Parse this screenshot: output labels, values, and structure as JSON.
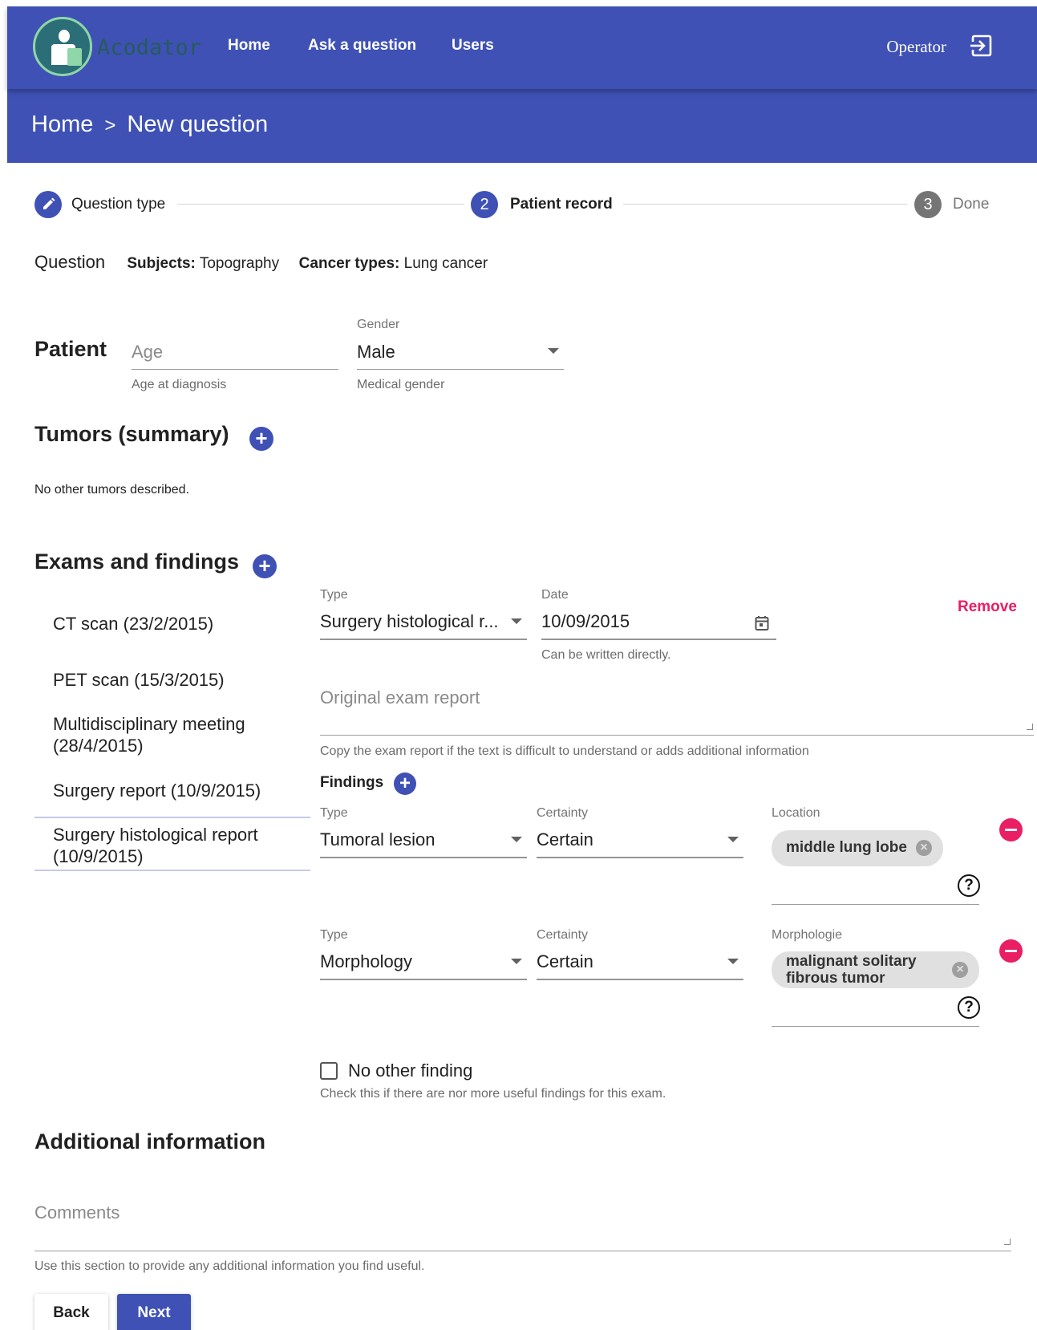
{
  "app": {
    "name": "Acodator"
  },
  "nav": {
    "home": "Home",
    "ask": "Ask a question",
    "users": "Users",
    "operator": "Operator"
  },
  "breadcrumb": {
    "home": "Home",
    "separator": ">",
    "current": "New question"
  },
  "stepper": {
    "steps": [
      {
        "label": "Question type",
        "state": "edit"
      },
      {
        "number": "2",
        "label": "Patient record",
        "state": "active"
      },
      {
        "number": "3",
        "label": "Done",
        "state": "pending"
      }
    ]
  },
  "question": {
    "title": "Question",
    "subjects_label": "Subjects:",
    "subjects_value": "Topography",
    "cancer_label": "Cancer types:",
    "cancer_value": "Lung cancer"
  },
  "patient": {
    "title": "Patient",
    "age_placeholder": "Age",
    "age_hint": "Age at diagnosis",
    "gender_label": "Gender",
    "gender_value": "Male",
    "gender_hint": "Medical gender"
  },
  "tumors": {
    "title": "Tumors (summary)",
    "empty_text": "No other tumors described."
  },
  "exams": {
    "title": "Exams and findings",
    "list": [
      {
        "label": "CT scan (23/2/2015)"
      },
      {
        "label": "PET scan (15/3/2015)"
      },
      {
        "label": "Multidisciplinary meeting (28/4/2015)"
      },
      {
        "label": "Surgery report (10/9/2015)"
      },
      {
        "label": "Surgery histological report (10/9/2015)"
      }
    ],
    "detail": {
      "type_label": "Type",
      "type_value": "Surgery histological r...",
      "date_label": "Date",
      "date_value": "10/09/2015",
      "date_hint": "Can be written directly.",
      "remove": "Remove",
      "report_placeholder": "Original exam report",
      "report_hint": "Copy the exam report if the text is difficult to understand or adds additional information",
      "findings_title": "Findings",
      "findings": [
        {
          "type_label": "Type",
          "type_value": "Tumoral lesion",
          "certainty_label": "Certainty",
          "certainty_value": "Certain",
          "extra_label": "Location",
          "chip": "middle lung lobe"
        },
        {
          "type_label": "Type",
          "type_value": "Morphology",
          "certainty_label": "Certainty",
          "certainty_value": "Certain",
          "extra_label": "Morphologie",
          "chip_line1": "malignant solitary",
          "chip_line2": "fibrous tumor"
        }
      ],
      "no_other_label": "No other finding",
      "no_other_hint": "Check this if there are nor more useful findings for this exam."
    }
  },
  "additional": {
    "title": "Additional information",
    "comments_placeholder": "Comments",
    "comments_hint": "Use this section to provide any additional information you find useful."
  },
  "buttons": {
    "back": "Back",
    "next": "Next"
  },
  "colors": {
    "primary": "#3f51b5",
    "accent": "#e91e63"
  }
}
